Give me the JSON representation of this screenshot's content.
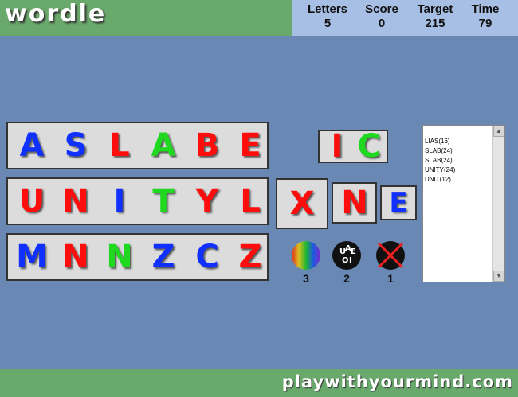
{
  "header": {
    "title": "wordle",
    "stats": [
      {
        "label": "Letters",
        "value": "5"
      },
      {
        "label": "Score",
        "value": "0"
      },
      {
        "label": "Target",
        "value": "215"
      },
      {
        "label": "Time",
        "value": "79"
      }
    ]
  },
  "rows": [
    {
      "letters": [
        {
          "char": "A",
          "color": "blue"
        },
        {
          "char": "S",
          "color": "blue"
        },
        {
          "char": "L",
          "color": "red"
        },
        {
          "char": "A",
          "color": "green"
        },
        {
          "char": "B",
          "color": "red"
        },
        {
          "char": "E",
          "color": "red"
        }
      ]
    },
    {
      "letters": [
        {
          "char": "U",
          "color": "red"
        },
        {
          "char": "N",
          "color": "red"
        },
        {
          "char": "I",
          "color": "blue"
        },
        {
          "char": "T",
          "color": "green"
        },
        {
          "char": "Y",
          "color": "red"
        },
        {
          "char": "L",
          "color": "red"
        }
      ]
    },
    {
      "letters": [
        {
          "char": "M",
          "color": "blue"
        },
        {
          "char": "N",
          "color": "red"
        },
        {
          "char": "N",
          "color": "green"
        },
        {
          "char": "Z",
          "color": "blue"
        },
        {
          "char": "C",
          "color": "blue"
        },
        {
          "char": "Z",
          "color": "red"
        }
      ]
    }
  ],
  "ic_box": [
    {
      "char": "I",
      "color": "red"
    },
    {
      "char": "C",
      "color": "green"
    }
  ],
  "singles": [
    {
      "char": "X",
      "color": "red"
    },
    {
      "char": "N",
      "color": "red"
    },
    {
      "char": "E",
      "color": "blue"
    }
  ],
  "word_list": [
    "LIAS(16)",
    "SLAB(24)",
    "SLAB(24)",
    "UNITY(24)",
    "UNIT(12)"
  ],
  "powerups": [
    {
      "name": "color-shuffle",
      "count": "3"
    },
    {
      "name": "vowels",
      "count": "2",
      "icon_text": "U A E O I"
    },
    {
      "name": "blocked",
      "count": "1"
    }
  ],
  "footer": {
    "site": "playwithyourmind.com"
  },
  "colors": {
    "red": "#ff0d0d",
    "blue": "#1030ff",
    "green": "#20d820"
  }
}
